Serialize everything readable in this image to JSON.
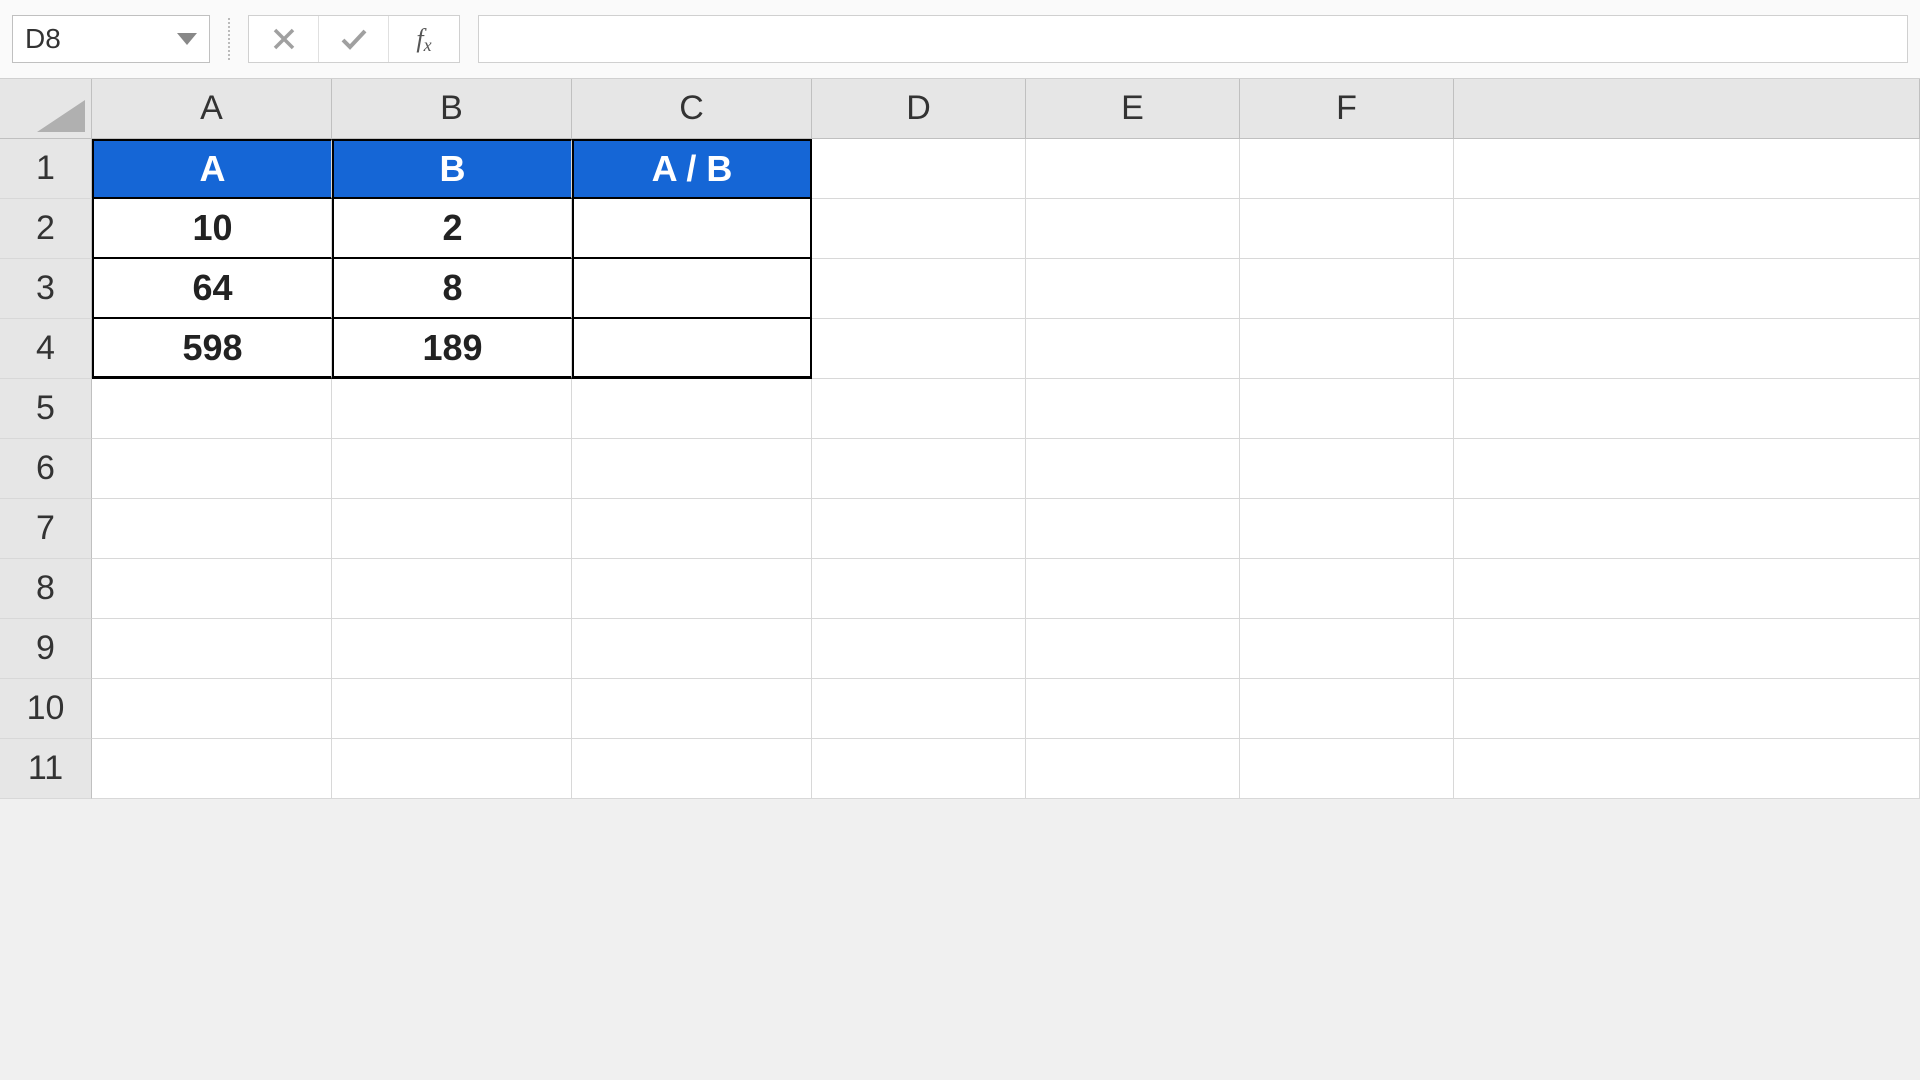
{
  "name_box": {
    "value": "D8"
  },
  "formula_input": {
    "value": ""
  },
  "col_headers": [
    "A",
    "B",
    "C",
    "D",
    "E",
    "F"
  ],
  "row_headers": [
    "1",
    "2",
    "3",
    "4",
    "5",
    "6",
    "7",
    "8",
    "9",
    "10",
    "11"
  ],
  "table": {
    "headers": [
      "A",
      "B",
      "A / B"
    ],
    "rows": [
      {
        "a": "10",
        "b": "2",
        "c": ""
      },
      {
        "a": "64",
        "b": "8",
        "c": ""
      },
      {
        "a": "598",
        "b": "189",
        "c": ""
      }
    ]
  },
  "fx_label": {
    "f": "f",
    "x": "x"
  },
  "chart_data": {
    "type": "table",
    "title": "",
    "columns": [
      "A",
      "B",
      "A / B"
    ],
    "rows": [
      [
        10,
        2,
        null
      ],
      [
        64,
        8,
        null
      ],
      [
        598,
        189,
        null
      ]
    ]
  }
}
